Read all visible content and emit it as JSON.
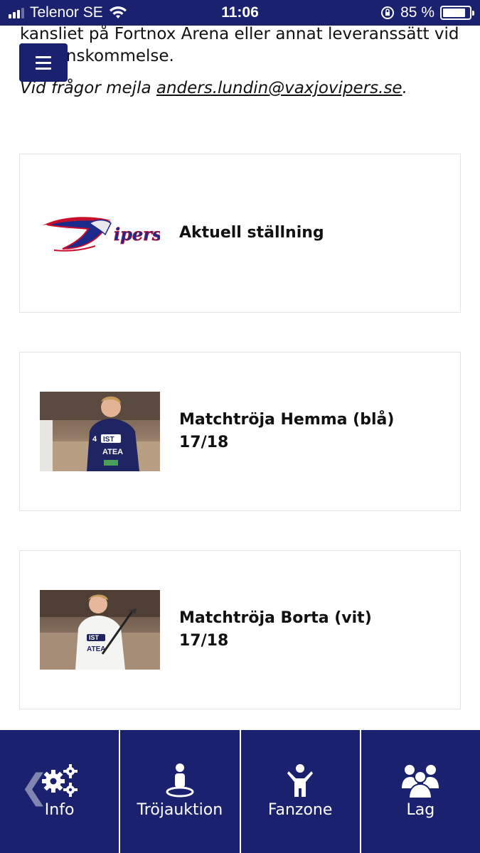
{
  "status_bar": {
    "carrier": "Telenor SE",
    "time": "11:06",
    "battery": "85 %",
    "battery_level": 0.85
  },
  "intro": {
    "line1": "kansliet på Fortnox Arena eller annat leveranssätt vid",
    "line2": "överenskommelse.",
    "question_prefix": "Vid frågor mejla ",
    "email": "anders.lundin@vaxjovipers.se",
    "question_suffix": "."
  },
  "cards": [
    {
      "title": "Aktuell ställning",
      "image": "vipers-logo"
    },
    {
      "title": "Matchtröja Hemma (blå) 17/18",
      "image": "player-home-jersey-photo"
    },
    {
      "title": "Matchtröja Borta (vit) 17/18",
      "image": "player-away-jersey-photo"
    }
  ],
  "tabbar": {
    "tabs": [
      {
        "label": "Info",
        "icon": "gears-icon"
      },
      {
        "label": "Tröjauktion",
        "icon": "person-pin-icon"
      },
      {
        "label": "Fanzone",
        "icon": "person-cheer-icon"
      },
      {
        "label": "Lag",
        "icon": "group-icon"
      }
    ],
    "back_icon": "chevron-left-icon"
  },
  "colors": {
    "brand_navy": "#1a2270",
    "card_border": "#e4e4e4"
  }
}
